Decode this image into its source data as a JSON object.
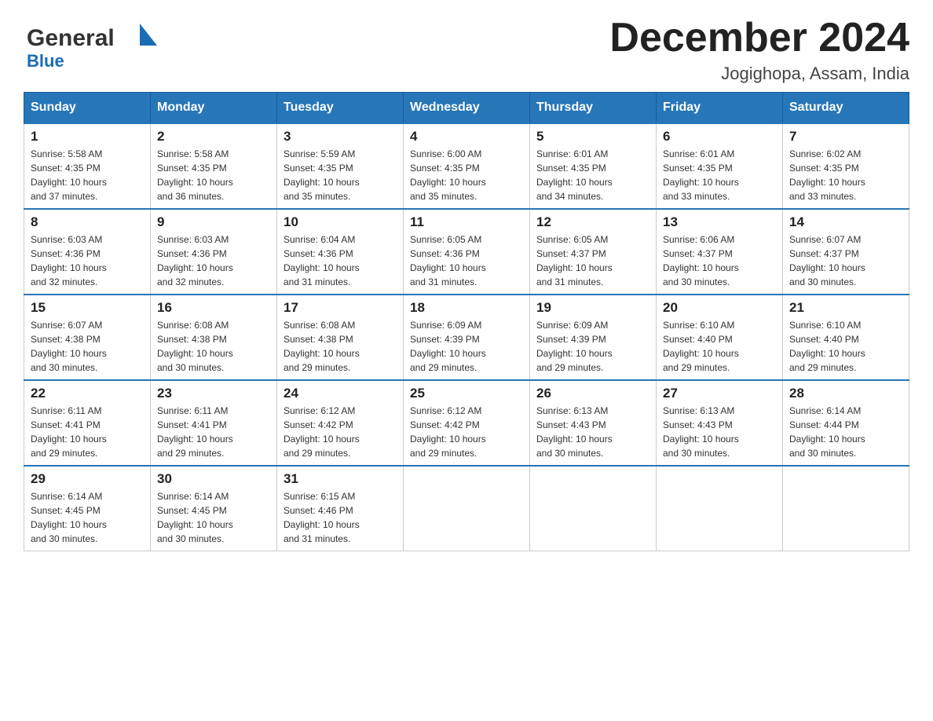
{
  "header": {
    "title": "December 2024",
    "subtitle": "Jogighopa, Assam, India",
    "logo_general": "General",
    "logo_blue": "Blue"
  },
  "columns": [
    "Sunday",
    "Monday",
    "Tuesday",
    "Wednesday",
    "Thursday",
    "Friday",
    "Saturday"
  ],
  "weeks": [
    [
      {
        "day": "1",
        "sunrise": "5:58 AM",
        "sunset": "4:35 PM",
        "daylight": "10 hours and 37 minutes."
      },
      {
        "day": "2",
        "sunrise": "5:58 AM",
        "sunset": "4:35 PM",
        "daylight": "10 hours and 36 minutes."
      },
      {
        "day": "3",
        "sunrise": "5:59 AM",
        "sunset": "4:35 PM",
        "daylight": "10 hours and 35 minutes."
      },
      {
        "day": "4",
        "sunrise": "6:00 AM",
        "sunset": "4:35 PM",
        "daylight": "10 hours and 35 minutes."
      },
      {
        "day": "5",
        "sunrise": "6:01 AM",
        "sunset": "4:35 PM",
        "daylight": "10 hours and 34 minutes."
      },
      {
        "day": "6",
        "sunrise": "6:01 AM",
        "sunset": "4:35 PM",
        "daylight": "10 hours and 33 minutes."
      },
      {
        "day": "7",
        "sunrise": "6:02 AM",
        "sunset": "4:35 PM",
        "daylight": "10 hours and 33 minutes."
      }
    ],
    [
      {
        "day": "8",
        "sunrise": "6:03 AM",
        "sunset": "4:36 PM",
        "daylight": "10 hours and 32 minutes."
      },
      {
        "day": "9",
        "sunrise": "6:03 AM",
        "sunset": "4:36 PM",
        "daylight": "10 hours and 32 minutes."
      },
      {
        "day": "10",
        "sunrise": "6:04 AM",
        "sunset": "4:36 PM",
        "daylight": "10 hours and 31 minutes."
      },
      {
        "day": "11",
        "sunrise": "6:05 AM",
        "sunset": "4:36 PM",
        "daylight": "10 hours and 31 minutes."
      },
      {
        "day": "12",
        "sunrise": "6:05 AM",
        "sunset": "4:37 PM",
        "daylight": "10 hours and 31 minutes."
      },
      {
        "day": "13",
        "sunrise": "6:06 AM",
        "sunset": "4:37 PM",
        "daylight": "10 hours and 30 minutes."
      },
      {
        "day": "14",
        "sunrise": "6:07 AM",
        "sunset": "4:37 PM",
        "daylight": "10 hours and 30 minutes."
      }
    ],
    [
      {
        "day": "15",
        "sunrise": "6:07 AM",
        "sunset": "4:38 PM",
        "daylight": "10 hours and 30 minutes."
      },
      {
        "day": "16",
        "sunrise": "6:08 AM",
        "sunset": "4:38 PM",
        "daylight": "10 hours and 30 minutes."
      },
      {
        "day": "17",
        "sunrise": "6:08 AM",
        "sunset": "4:38 PM",
        "daylight": "10 hours and 29 minutes."
      },
      {
        "day": "18",
        "sunrise": "6:09 AM",
        "sunset": "4:39 PM",
        "daylight": "10 hours and 29 minutes."
      },
      {
        "day": "19",
        "sunrise": "6:09 AM",
        "sunset": "4:39 PM",
        "daylight": "10 hours and 29 minutes."
      },
      {
        "day": "20",
        "sunrise": "6:10 AM",
        "sunset": "4:40 PM",
        "daylight": "10 hours and 29 minutes."
      },
      {
        "day": "21",
        "sunrise": "6:10 AM",
        "sunset": "4:40 PM",
        "daylight": "10 hours and 29 minutes."
      }
    ],
    [
      {
        "day": "22",
        "sunrise": "6:11 AM",
        "sunset": "4:41 PM",
        "daylight": "10 hours and 29 minutes."
      },
      {
        "day": "23",
        "sunrise": "6:11 AM",
        "sunset": "4:41 PM",
        "daylight": "10 hours and 29 minutes."
      },
      {
        "day": "24",
        "sunrise": "6:12 AM",
        "sunset": "4:42 PM",
        "daylight": "10 hours and 29 minutes."
      },
      {
        "day": "25",
        "sunrise": "6:12 AM",
        "sunset": "4:42 PM",
        "daylight": "10 hours and 29 minutes."
      },
      {
        "day": "26",
        "sunrise": "6:13 AM",
        "sunset": "4:43 PM",
        "daylight": "10 hours and 30 minutes."
      },
      {
        "day": "27",
        "sunrise": "6:13 AM",
        "sunset": "4:43 PM",
        "daylight": "10 hours and 30 minutes."
      },
      {
        "day": "28",
        "sunrise": "6:14 AM",
        "sunset": "4:44 PM",
        "daylight": "10 hours and 30 minutes."
      }
    ],
    [
      {
        "day": "29",
        "sunrise": "6:14 AM",
        "sunset": "4:45 PM",
        "daylight": "10 hours and 30 minutes."
      },
      {
        "day": "30",
        "sunrise": "6:14 AM",
        "sunset": "4:45 PM",
        "daylight": "10 hours and 30 minutes."
      },
      {
        "day": "31",
        "sunrise": "6:15 AM",
        "sunset": "4:46 PM",
        "daylight": "10 hours and 31 minutes."
      },
      null,
      null,
      null,
      null
    ]
  ],
  "sunrise_label": "Sunrise:",
  "sunset_label": "Sunset:",
  "daylight_label": "Daylight:"
}
